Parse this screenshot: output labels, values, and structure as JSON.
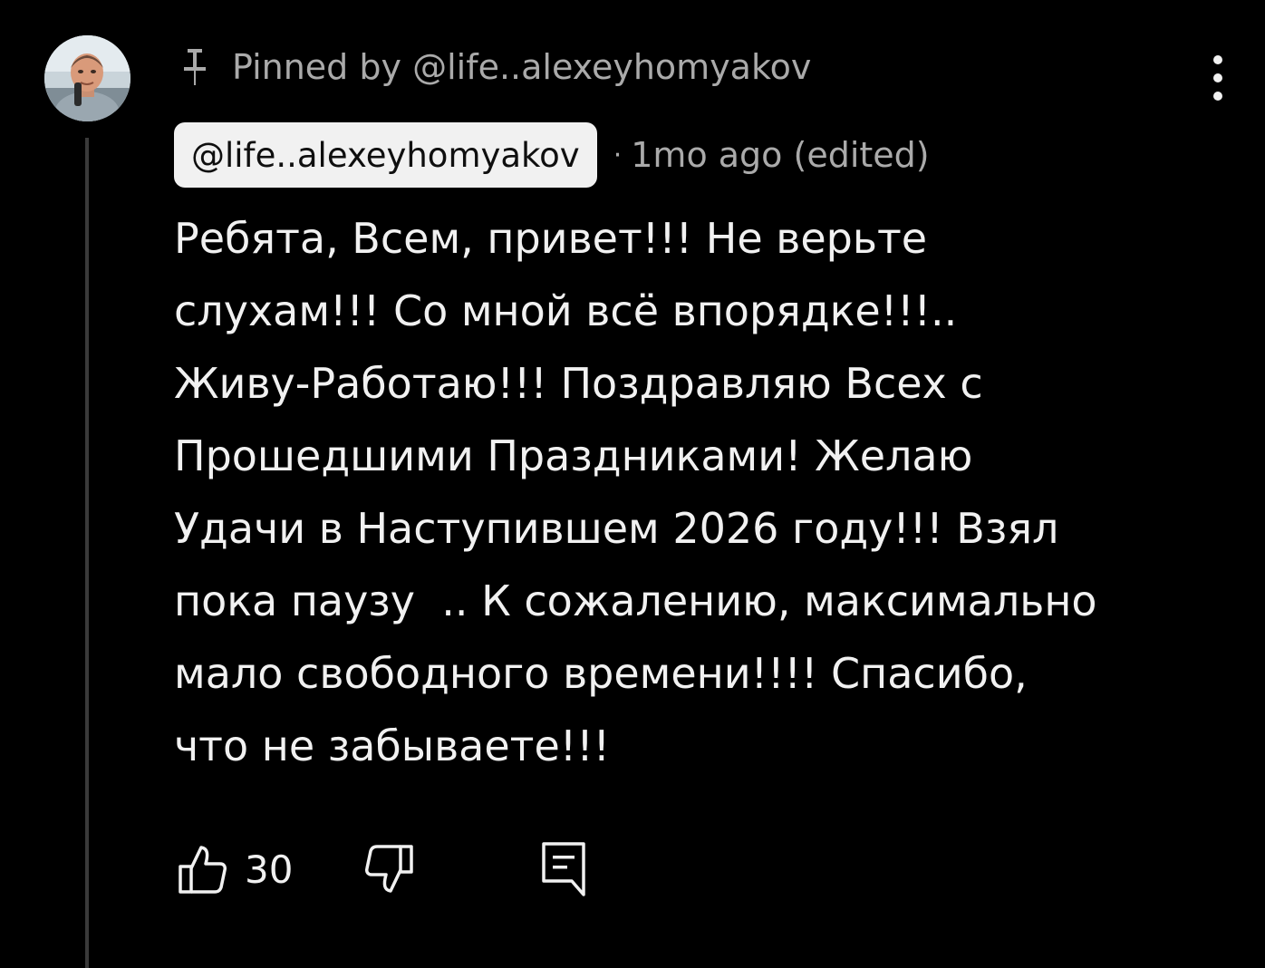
{
  "comment": {
    "pinned_label": "Pinned by @life..alexeyhomyakov",
    "author": "@life..alexeyhomyakov",
    "separator": "·",
    "timestamp": "1mo ago (edited)",
    "text": "Ребята, Всем, привет!!! Не верьте\nслухам!!! Со мной всё впорядке!!!..\nЖиву-Работаю!!! Поздравляю Всех с\nПрошедшими Праздниками! Желаю\nУдачи в Наступившем 2026 году!!! Взял\nпока паузу  .. К сожалению, максимально\nмало свободного времени!!!! Спасибо,\nчто не забываете!!!",
    "like_count": "30"
  },
  "icons": {
    "avatar": "author-avatar",
    "pin": "pin-icon",
    "more": "more-vertical-icon",
    "like": "thumbs-up-icon",
    "dislike": "thumbs-down-icon",
    "reply": "reply-comment-icon"
  },
  "colors": {
    "background": "#000000",
    "text_primary": "#f1f1f1",
    "text_secondary": "#aaaaaa",
    "author_chip_bg": "#f1f1f1",
    "author_chip_text": "#0f0f0f",
    "thread_line": "#3a3a3a"
  }
}
